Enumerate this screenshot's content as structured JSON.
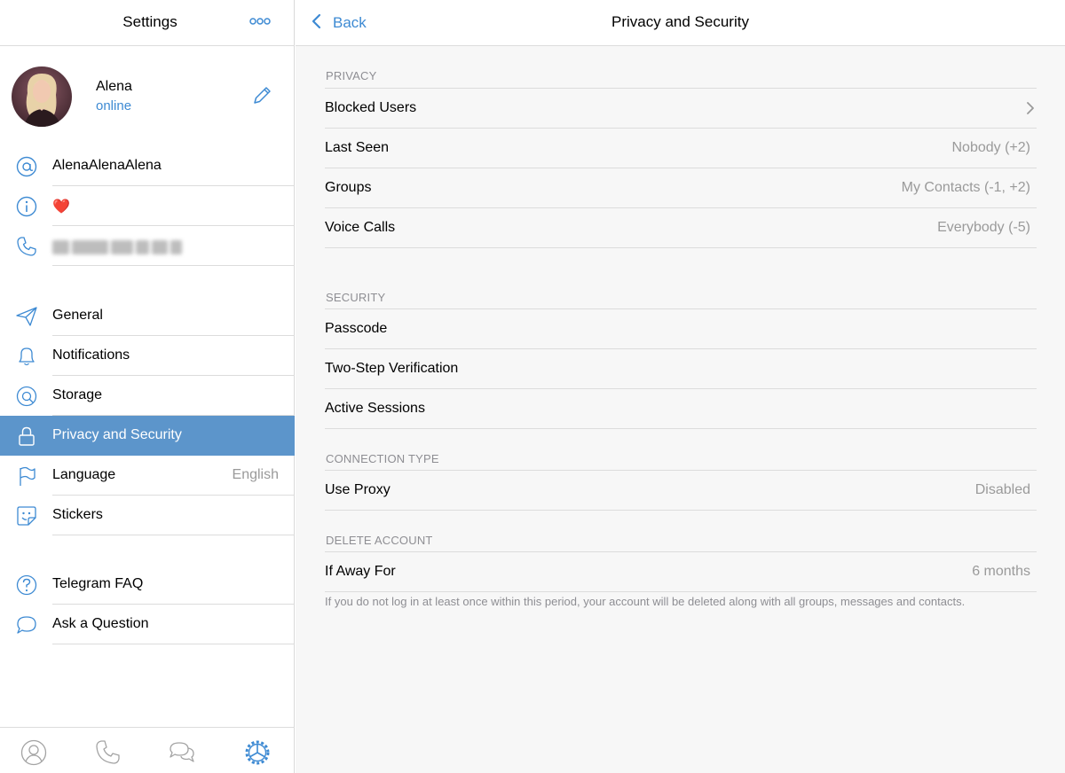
{
  "left_header": {
    "title": "Settings",
    "more_icon": "more-icon"
  },
  "profile": {
    "name": "Alena",
    "status": "online"
  },
  "info_rows": [
    {
      "icon": "at-icon",
      "label": "AlenaAlenaAlena"
    },
    {
      "icon": "info-icon",
      "label": "❤️"
    },
    {
      "icon": "phone-icon",
      "label": ""
    }
  ],
  "menu": [
    {
      "icon": "paper-plane-icon",
      "label": "General"
    },
    {
      "icon": "bell-icon",
      "label": "Notifications"
    },
    {
      "icon": "storage-icon",
      "label": "Storage"
    },
    {
      "icon": "lock-icon",
      "label": "Privacy and Security",
      "selected": true
    },
    {
      "icon": "flag-icon",
      "label": "Language",
      "value": "English"
    },
    {
      "icon": "sticker-icon",
      "label": "Stickers"
    }
  ],
  "help": [
    {
      "icon": "question-icon",
      "label": "Telegram FAQ"
    },
    {
      "icon": "speech-bubble-icon",
      "label": "Ask a Question"
    }
  ],
  "tabs": [
    "contacts-tab-icon",
    "calls-tab-icon",
    "chats-tab-icon",
    "settings-tab-icon"
  ],
  "right_header": {
    "back_label": "Back",
    "title": "Privacy and Security"
  },
  "sections": {
    "privacy": {
      "header": "PRIVACY",
      "rows": [
        {
          "label": "Blocked Users",
          "value": ""
        },
        {
          "label": "Last Seen",
          "value": "Nobody (+2)"
        },
        {
          "label": "Groups",
          "value": "My Contacts (-1, +2)"
        },
        {
          "label": "Voice Calls",
          "value": "Everybody (-5)"
        }
      ]
    },
    "security": {
      "header": "SECURITY",
      "rows": [
        {
          "label": "Passcode"
        },
        {
          "label": "Two-Step Verification"
        },
        {
          "label": "Active Sessions"
        }
      ]
    },
    "connection": {
      "header": "CONNECTION TYPE",
      "rows": [
        {
          "label": "Use Proxy",
          "value": "Disabled"
        }
      ]
    },
    "delete_account": {
      "header": "DELETE ACCOUNT",
      "rows": [
        {
          "label": "If Away For",
          "value": "6 months"
        }
      ],
      "footer": "If you do not log in at least once within this period, your account will be deleted along with all groups, messages and contacts."
    }
  },
  "colors": {
    "accent": "#3d8ad3",
    "selected_row": "#5c95cb",
    "secondary_text": "#9a9a9a",
    "separator": "#dcdcdc"
  }
}
